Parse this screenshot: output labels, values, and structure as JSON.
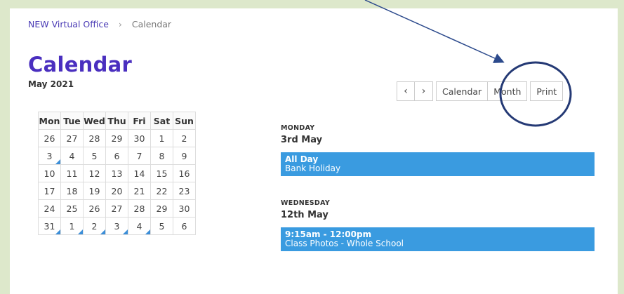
{
  "breadcrumb": {
    "link": "NEW Virtual Office",
    "separator": "›",
    "current": "Calendar"
  },
  "header": {
    "title": "Calendar",
    "subtitle": "May 2021"
  },
  "toolbar": {
    "prev_icon": "‹",
    "next_icon": "›",
    "calendar_label": "Calendar",
    "month_label": "Month",
    "print_label": "Print"
  },
  "calendar": {
    "weekdays": [
      "Mon",
      "Tue",
      "Wed",
      "Thu",
      "Fri",
      "Sat",
      "Sun"
    ],
    "rows": [
      [
        "26",
        "27",
        "28",
        "29",
        "30",
        "1",
        "2"
      ],
      [
        "3",
        "4",
        "5",
        "6",
        "7",
        "8",
        "9"
      ],
      [
        "10",
        "11",
        "12",
        "13",
        "14",
        "15",
        "16"
      ],
      [
        "17",
        "18",
        "19",
        "20",
        "21",
        "22",
        "23"
      ],
      [
        "24",
        "25",
        "26",
        "27",
        "28",
        "29",
        "30"
      ],
      [
        "31",
        "1",
        "2",
        "3",
        "4",
        "5",
        "6"
      ]
    ]
  },
  "agenda": [
    {
      "day": "MONDAY",
      "date": "3rd May",
      "time": "All Day",
      "title": "Bank Holiday"
    },
    {
      "day": "WEDNESDAY",
      "date": "12th May",
      "time": "9:15am - 12:00pm",
      "title": "Class Photos - Whole School"
    }
  ],
  "colors": {
    "accent": "#4a2fbf",
    "event": "#3a9be0",
    "annotation": "#2c4a8c",
    "background": "#dde8cb"
  }
}
